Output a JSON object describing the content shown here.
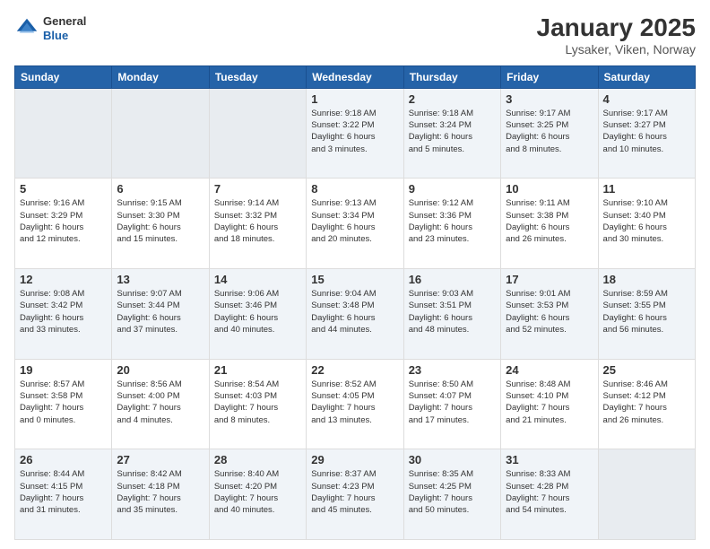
{
  "header": {
    "logo": {
      "general": "General",
      "blue": "Blue"
    },
    "title": "January 2025",
    "subtitle": "Lysaker, Viken, Norway"
  },
  "calendar": {
    "days_of_week": [
      "Sunday",
      "Monday",
      "Tuesday",
      "Wednesday",
      "Thursday",
      "Friday",
      "Saturday"
    ],
    "weeks": [
      [
        {
          "day": "",
          "info": ""
        },
        {
          "day": "",
          "info": ""
        },
        {
          "day": "",
          "info": ""
        },
        {
          "day": "1",
          "info": "Sunrise: 9:18 AM\nSunset: 3:22 PM\nDaylight: 6 hours\nand 3 minutes."
        },
        {
          "day": "2",
          "info": "Sunrise: 9:18 AM\nSunset: 3:24 PM\nDaylight: 6 hours\nand 5 minutes."
        },
        {
          "day": "3",
          "info": "Sunrise: 9:17 AM\nSunset: 3:25 PM\nDaylight: 6 hours\nand 8 minutes."
        },
        {
          "day": "4",
          "info": "Sunrise: 9:17 AM\nSunset: 3:27 PM\nDaylight: 6 hours\nand 10 minutes."
        }
      ],
      [
        {
          "day": "5",
          "info": "Sunrise: 9:16 AM\nSunset: 3:29 PM\nDaylight: 6 hours\nand 12 minutes."
        },
        {
          "day": "6",
          "info": "Sunrise: 9:15 AM\nSunset: 3:30 PM\nDaylight: 6 hours\nand 15 minutes."
        },
        {
          "day": "7",
          "info": "Sunrise: 9:14 AM\nSunset: 3:32 PM\nDaylight: 6 hours\nand 18 minutes."
        },
        {
          "day": "8",
          "info": "Sunrise: 9:13 AM\nSunset: 3:34 PM\nDaylight: 6 hours\nand 20 minutes."
        },
        {
          "day": "9",
          "info": "Sunrise: 9:12 AM\nSunset: 3:36 PM\nDaylight: 6 hours\nand 23 minutes."
        },
        {
          "day": "10",
          "info": "Sunrise: 9:11 AM\nSunset: 3:38 PM\nDaylight: 6 hours\nand 26 minutes."
        },
        {
          "day": "11",
          "info": "Sunrise: 9:10 AM\nSunset: 3:40 PM\nDaylight: 6 hours\nand 30 minutes."
        }
      ],
      [
        {
          "day": "12",
          "info": "Sunrise: 9:08 AM\nSunset: 3:42 PM\nDaylight: 6 hours\nand 33 minutes."
        },
        {
          "day": "13",
          "info": "Sunrise: 9:07 AM\nSunset: 3:44 PM\nDaylight: 6 hours\nand 37 minutes."
        },
        {
          "day": "14",
          "info": "Sunrise: 9:06 AM\nSunset: 3:46 PM\nDaylight: 6 hours\nand 40 minutes."
        },
        {
          "day": "15",
          "info": "Sunrise: 9:04 AM\nSunset: 3:48 PM\nDaylight: 6 hours\nand 44 minutes."
        },
        {
          "day": "16",
          "info": "Sunrise: 9:03 AM\nSunset: 3:51 PM\nDaylight: 6 hours\nand 48 minutes."
        },
        {
          "day": "17",
          "info": "Sunrise: 9:01 AM\nSunset: 3:53 PM\nDaylight: 6 hours\nand 52 minutes."
        },
        {
          "day": "18",
          "info": "Sunrise: 8:59 AM\nSunset: 3:55 PM\nDaylight: 6 hours\nand 56 minutes."
        }
      ],
      [
        {
          "day": "19",
          "info": "Sunrise: 8:57 AM\nSunset: 3:58 PM\nDaylight: 7 hours\nand 0 minutes."
        },
        {
          "day": "20",
          "info": "Sunrise: 8:56 AM\nSunset: 4:00 PM\nDaylight: 7 hours\nand 4 minutes."
        },
        {
          "day": "21",
          "info": "Sunrise: 8:54 AM\nSunset: 4:03 PM\nDaylight: 7 hours\nand 8 minutes."
        },
        {
          "day": "22",
          "info": "Sunrise: 8:52 AM\nSunset: 4:05 PM\nDaylight: 7 hours\nand 13 minutes."
        },
        {
          "day": "23",
          "info": "Sunrise: 8:50 AM\nSunset: 4:07 PM\nDaylight: 7 hours\nand 17 minutes."
        },
        {
          "day": "24",
          "info": "Sunrise: 8:48 AM\nSunset: 4:10 PM\nDaylight: 7 hours\nand 21 minutes."
        },
        {
          "day": "25",
          "info": "Sunrise: 8:46 AM\nSunset: 4:12 PM\nDaylight: 7 hours\nand 26 minutes."
        }
      ],
      [
        {
          "day": "26",
          "info": "Sunrise: 8:44 AM\nSunset: 4:15 PM\nDaylight: 7 hours\nand 31 minutes."
        },
        {
          "day": "27",
          "info": "Sunrise: 8:42 AM\nSunset: 4:18 PM\nDaylight: 7 hours\nand 35 minutes."
        },
        {
          "day": "28",
          "info": "Sunrise: 8:40 AM\nSunset: 4:20 PM\nDaylight: 7 hours\nand 40 minutes."
        },
        {
          "day": "29",
          "info": "Sunrise: 8:37 AM\nSunset: 4:23 PM\nDaylight: 7 hours\nand 45 minutes."
        },
        {
          "day": "30",
          "info": "Sunrise: 8:35 AM\nSunset: 4:25 PM\nDaylight: 7 hours\nand 50 minutes."
        },
        {
          "day": "31",
          "info": "Sunrise: 8:33 AM\nSunset: 4:28 PM\nDaylight: 7 hours\nand 54 minutes."
        },
        {
          "day": "",
          "info": ""
        }
      ]
    ]
  }
}
